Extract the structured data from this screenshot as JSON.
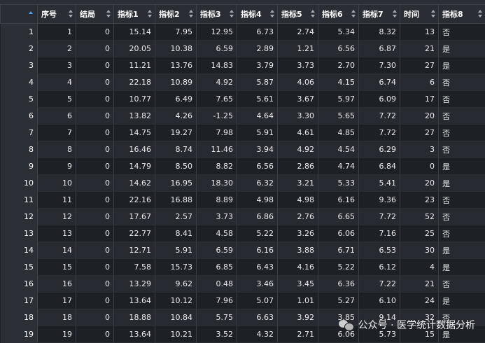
{
  "columns": [
    "",
    "序号",
    "结局",
    "指标1",
    "指标2",
    "指标3",
    "指标4",
    "指标5",
    "指标6",
    "指标7",
    "时间",
    "指标8"
  ],
  "rows": [
    [
      "1",
      "1",
      "0",
      "15.14",
      "7.95",
      "12.95",
      "6.73",
      "2.74",
      "5.34",
      "8.32",
      "13",
      "否"
    ],
    [
      "2",
      "2",
      "0",
      "20.05",
      "10.38",
      "6.59",
      "2.89",
      "1.21",
      "6.56",
      "6.87",
      "21",
      "是"
    ],
    [
      "3",
      "3",
      "0",
      "11.21",
      "13.76",
      "14.83",
      "3.79",
      "3.73",
      "2.70",
      "7.30",
      "27",
      "是"
    ],
    [
      "4",
      "4",
      "0",
      "22.18",
      "10.89",
      "4.92",
      "5.87",
      "4.06",
      "4.15",
      "6.74",
      "6",
      "否"
    ],
    [
      "5",
      "5",
      "0",
      "10.77",
      "6.49",
      "7.65",
      "5.61",
      "3.67",
      "5.97",
      "6.09",
      "17",
      "否"
    ],
    [
      "6",
      "6",
      "0",
      "13.82",
      "4.26",
      "-1.25",
      "4.64",
      "3.30",
      "5.65",
      "7.72",
      "20",
      "否"
    ],
    [
      "7",
      "7",
      "0",
      "14.75",
      "19.27",
      "7.98",
      "5.91",
      "4.61",
      "4.85",
      "7.72",
      "27",
      "否"
    ],
    [
      "8",
      "8",
      "0",
      "16.46",
      "8.74",
      "11.46",
      "3.94",
      "4.92",
      "4.54",
      "6.29",
      "3",
      "否"
    ],
    [
      "9",
      "9",
      "0",
      "14.79",
      "8.50",
      "8.82",
      "6.56",
      "2.86",
      "4.74",
      "6.84",
      "0",
      "是"
    ],
    [
      "10",
      "10",
      "0",
      "14.62",
      "16.95",
      "18.30",
      "6.32",
      "3.21",
      "5.33",
      "5.41",
      "20",
      "是"
    ],
    [
      "11",
      "11",
      "0",
      "22.16",
      "16.88",
      "8.89",
      "4.98",
      "4.98",
      "6.16",
      "9.36",
      "23",
      "否"
    ],
    [
      "12",
      "12",
      "0",
      "17.67",
      "2.57",
      "3.73",
      "6.86",
      "2.76",
      "6.65",
      "7.72",
      "52",
      "否"
    ],
    [
      "13",
      "13",
      "0",
      "22.77",
      "8.41",
      "4.58",
      "5.22",
      "3.26",
      "6.06",
      "7.16",
      "25",
      "否"
    ],
    [
      "14",
      "14",
      "0",
      "12.71",
      "5.91",
      "6.59",
      "6.16",
      "3.88",
      "6.71",
      "6.53",
      "30",
      "是"
    ],
    [
      "15",
      "15",
      "0",
      "7.58",
      "15.73",
      "6.85",
      "6.43",
      "4.16",
      "5.22",
      "6.12",
      "4",
      "是"
    ],
    [
      "16",
      "16",
      "0",
      "13.29",
      "9.62",
      "0.48",
      "3.46",
      "3.45",
      "6.36",
      "7.22",
      "21",
      "否"
    ],
    [
      "17",
      "17",
      "0",
      "13.64",
      "10.12",
      "7.96",
      "5.07",
      "1.01",
      "5.27",
      "6.10",
      "24",
      "是"
    ],
    [
      "18",
      "18",
      "0",
      "18.88",
      "10.84",
      "5.75",
      "6.63",
      "3.92",
      "3.85",
      "9.14",
      "32",
      "否"
    ],
    [
      "19",
      "19",
      "0",
      "13.64",
      "10.21",
      "3.52",
      "4.32",
      "2.71",
      "6.06",
      "5.73",
      "15",
      "是"
    ]
  ],
  "watermark": "公众号 · 医学统计数据分析",
  "colors": {
    "header_bg": "#2a2e34",
    "row_odd": "#1d2025",
    "row_even": "#272a30",
    "sort_active": "#4aa3f0"
  }
}
